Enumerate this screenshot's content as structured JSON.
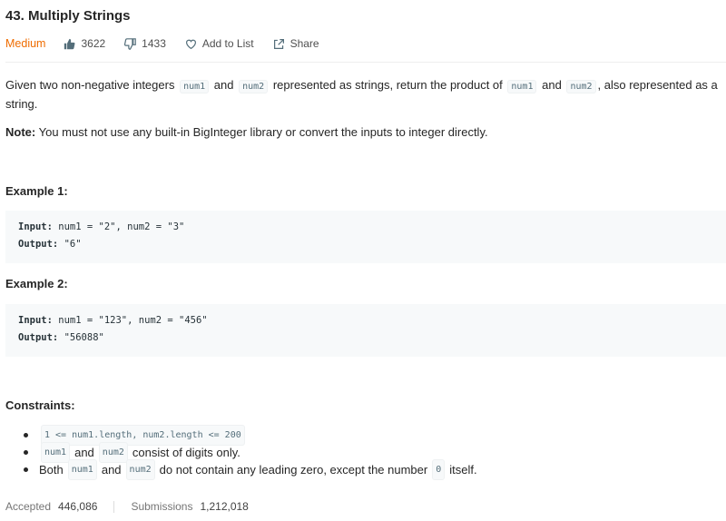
{
  "problem": {
    "title": "43. Multiply Strings",
    "difficulty": "Medium",
    "likes": "3622",
    "dislikes": "1433",
    "add_to_list": "Add to List",
    "share": "Share"
  },
  "description": {
    "p1_a": "Given two non-negative integers",
    "num1": "num1",
    "p1_b": "and",
    "num2": "num2",
    "p1_c": "represented as strings, return the product of",
    "p1_d": "and",
    "p1_e": ", also represented as a",
    "p1_f": "string.",
    "note_label": "Note:",
    "note_text": "You must not use any built-in BigInteger library or convert the inputs to integer directly."
  },
  "examples": [
    {
      "heading": "Example 1:",
      "input_label": "Input:",
      "input": "num1 = \"2\", num2 = \"3\"",
      "output_label": "Output:",
      "output": "\"6\""
    },
    {
      "heading": "Example 2:",
      "input_label": "Input:",
      "input": "num1 = \"123\", num2 = \"456\"",
      "output_label": "Output:",
      "output": "\"56088\""
    }
  ],
  "constraints": {
    "heading": "Constraints:",
    "c1_code": "1 <= num1.length, num2.length <= 200",
    "c2_num1": "num1",
    "c2_and": "and",
    "c2_num2": "num2",
    "c2_text": "consist of digits only.",
    "c3_both": "Both",
    "c3_num1": "num1",
    "c3_and": "and",
    "c3_num2": "num2",
    "c3_text": "do not contain any leading zero, except the number",
    "c3_zero": "0",
    "c3_end": "itself."
  },
  "stats": {
    "accepted_label": "Accepted",
    "accepted": "446,086",
    "submissions_label": "Submissions",
    "submissions": "1,212,018"
  },
  "colors": {
    "difficulty": "#ef6c00",
    "code_bg": "#f7f9fa",
    "code_text": "#546e7a"
  }
}
